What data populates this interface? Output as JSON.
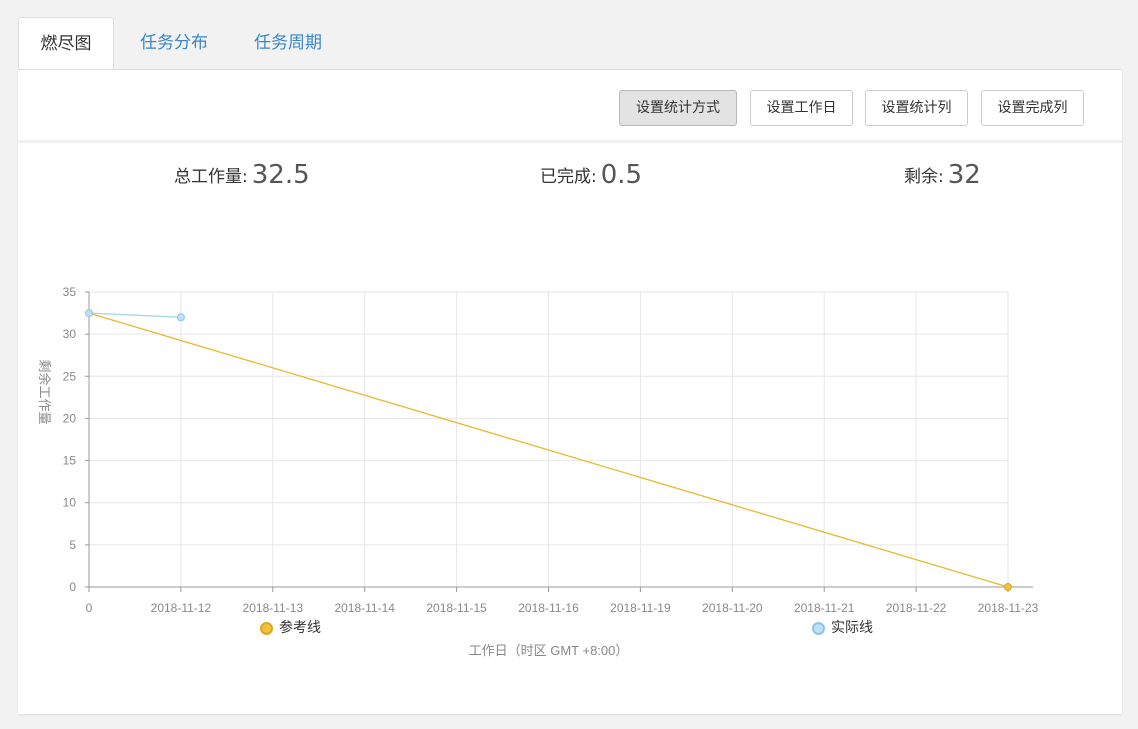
{
  "tabs": [
    {
      "label": "燃尽图",
      "active": true
    },
    {
      "label": "任务分布",
      "active": false
    },
    {
      "label": "任务周期",
      "active": false
    }
  ],
  "toolbar": {
    "buttons": [
      {
        "label": "设置统计方式",
        "active": true
      },
      {
        "label": "设置工作日",
        "active": false
      },
      {
        "label": "设置统计列",
        "active": false
      },
      {
        "label": "设置完成列",
        "active": false
      }
    ]
  },
  "stats": {
    "total_label": "总工作量:",
    "total_value": "32.5",
    "done_label": "已完成:",
    "done_value": "0.5",
    "remaining_label": "剩余:",
    "remaining_value": "32"
  },
  "colors": {
    "reference": "#e8b92d",
    "actual": "#a8d3f0",
    "tab_link": "#3a87c8"
  },
  "chart_data": {
    "type": "line",
    "ylabel": "剩余工作量",
    "xlabel": "工作日（时区 GMT +8:00）",
    "categories": [
      "0",
      "2018-11-12",
      "2018-11-13",
      "2018-11-14",
      "2018-11-15",
      "2018-11-16",
      "2018-11-19",
      "2018-11-20",
      "2018-11-21",
      "2018-11-22",
      "2018-11-23"
    ],
    "ylim": [
      0,
      35
    ],
    "yticks": [
      0,
      5,
      10,
      15,
      20,
      25,
      30,
      35
    ],
    "grid": true,
    "legend_position": "bottom",
    "series": [
      {
        "name": "参考线",
        "values": [
          32.5,
          null,
          null,
          null,
          null,
          null,
          null,
          null,
          null,
          null,
          0
        ]
      },
      {
        "name": "实际线",
        "values": [
          32.5,
          32,
          null,
          null,
          null,
          null,
          null,
          null,
          null,
          null,
          null
        ]
      }
    ]
  }
}
